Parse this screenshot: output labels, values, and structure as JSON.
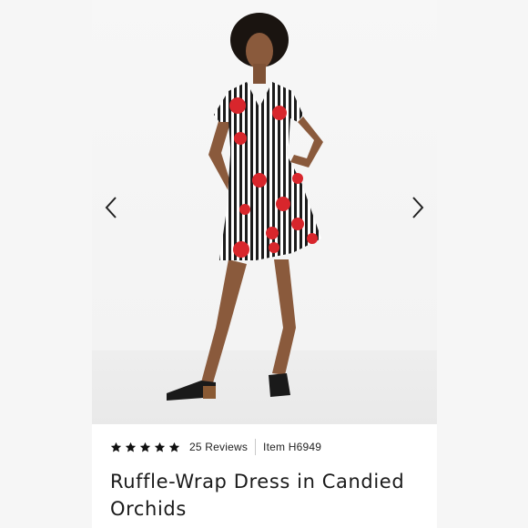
{
  "product": {
    "rating_stars": 5,
    "reviews_label": "25 Reviews",
    "item_label": "Item H6949",
    "title": "Ruffle-Wrap Dress in Candied Orchids"
  },
  "gallery": {
    "prev_icon": "chevron-left-icon",
    "next_icon": "chevron-right-icon"
  },
  "colors": {
    "star": "#111111",
    "dress_red": "#d8262c",
    "stripe": "#1c1c1c"
  }
}
